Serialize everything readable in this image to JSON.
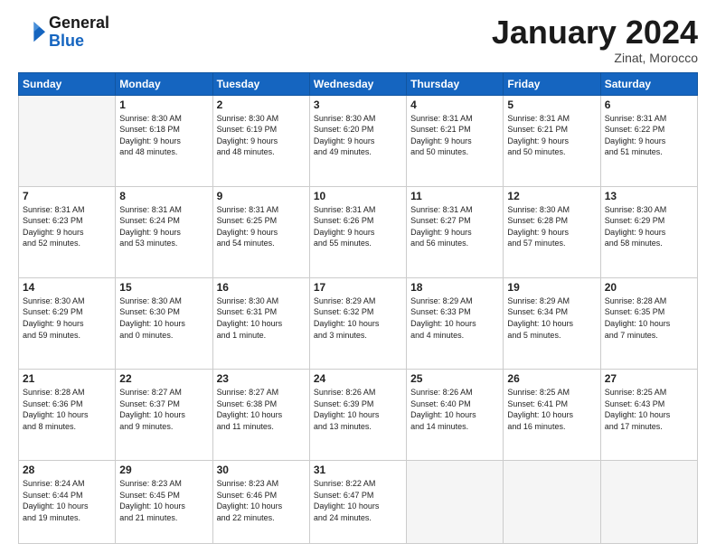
{
  "header": {
    "logo_general": "General",
    "logo_blue": "Blue",
    "month_title": "January 2024",
    "location": "Zinat, Morocco"
  },
  "days_of_week": [
    "Sunday",
    "Monday",
    "Tuesday",
    "Wednesday",
    "Thursday",
    "Friday",
    "Saturday"
  ],
  "weeks": [
    [
      {
        "day": "",
        "info": ""
      },
      {
        "day": "1",
        "info": "Sunrise: 8:30 AM\nSunset: 6:18 PM\nDaylight: 9 hours\nand 48 minutes."
      },
      {
        "day": "2",
        "info": "Sunrise: 8:30 AM\nSunset: 6:19 PM\nDaylight: 9 hours\nand 48 minutes."
      },
      {
        "day": "3",
        "info": "Sunrise: 8:30 AM\nSunset: 6:20 PM\nDaylight: 9 hours\nand 49 minutes."
      },
      {
        "day": "4",
        "info": "Sunrise: 8:31 AM\nSunset: 6:21 PM\nDaylight: 9 hours\nand 50 minutes."
      },
      {
        "day": "5",
        "info": "Sunrise: 8:31 AM\nSunset: 6:21 PM\nDaylight: 9 hours\nand 50 minutes."
      },
      {
        "day": "6",
        "info": "Sunrise: 8:31 AM\nSunset: 6:22 PM\nDaylight: 9 hours\nand 51 minutes."
      }
    ],
    [
      {
        "day": "7",
        "info": "Sunrise: 8:31 AM\nSunset: 6:23 PM\nDaylight: 9 hours\nand 52 minutes."
      },
      {
        "day": "8",
        "info": "Sunrise: 8:31 AM\nSunset: 6:24 PM\nDaylight: 9 hours\nand 53 minutes."
      },
      {
        "day": "9",
        "info": "Sunrise: 8:31 AM\nSunset: 6:25 PM\nDaylight: 9 hours\nand 54 minutes."
      },
      {
        "day": "10",
        "info": "Sunrise: 8:31 AM\nSunset: 6:26 PM\nDaylight: 9 hours\nand 55 minutes."
      },
      {
        "day": "11",
        "info": "Sunrise: 8:31 AM\nSunset: 6:27 PM\nDaylight: 9 hours\nand 56 minutes."
      },
      {
        "day": "12",
        "info": "Sunrise: 8:30 AM\nSunset: 6:28 PM\nDaylight: 9 hours\nand 57 minutes."
      },
      {
        "day": "13",
        "info": "Sunrise: 8:30 AM\nSunset: 6:29 PM\nDaylight: 9 hours\nand 58 minutes."
      }
    ],
    [
      {
        "day": "14",
        "info": "Sunrise: 8:30 AM\nSunset: 6:29 PM\nDaylight: 9 hours\nand 59 minutes."
      },
      {
        "day": "15",
        "info": "Sunrise: 8:30 AM\nSunset: 6:30 PM\nDaylight: 10 hours\nand 0 minutes."
      },
      {
        "day": "16",
        "info": "Sunrise: 8:30 AM\nSunset: 6:31 PM\nDaylight: 10 hours\nand 1 minute."
      },
      {
        "day": "17",
        "info": "Sunrise: 8:29 AM\nSunset: 6:32 PM\nDaylight: 10 hours\nand 3 minutes."
      },
      {
        "day": "18",
        "info": "Sunrise: 8:29 AM\nSunset: 6:33 PM\nDaylight: 10 hours\nand 4 minutes."
      },
      {
        "day": "19",
        "info": "Sunrise: 8:29 AM\nSunset: 6:34 PM\nDaylight: 10 hours\nand 5 minutes."
      },
      {
        "day": "20",
        "info": "Sunrise: 8:28 AM\nSunset: 6:35 PM\nDaylight: 10 hours\nand 7 minutes."
      }
    ],
    [
      {
        "day": "21",
        "info": "Sunrise: 8:28 AM\nSunset: 6:36 PM\nDaylight: 10 hours\nand 8 minutes."
      },
      {
        "day": "22",
        "info": "Sunrise: 8:27 AM\nSunset: 6:37 PM\nDaylight: 10 hours\nand 9 minutes."
      },
      {
        "day": "23",
        "info": "Sunrise: 8:27 AM\nSunset: 6:38 PM\nDaylight: 10 hours\nand 11 minutes."
      },
      {
        "day": "24",
        "info": "Sunrise: 8:26 AM\nSunset: 6:39 PM\nDaylight: 10 hours\nand 13 minutes."
      },
      {
        "day": "25",
        "info": "Sunrise: 8:26 AM\nSunset: 6:40 PM\nDaylight: 10 hours\nand 14 minutes."
      },
      {
        "day": "26",
        "info": "Sunrise: 8:25 AM\nSunset: 6:41 PM\nDaylight: 10 hours\nand 16 minutes."
      },
      {
        "day": "27",
        "info": "Sunrise: 8:25 AM\nSunset: 6:43 PM\nDaylight: 10 hours\nand 17 minutes."
      }
    ],
    [
      {
        "day": "28",
        "info": "Sunrise: 8:24 AM\nSunset: 6:44 PM\nDaylight: 10 hours\nand 19 minutes."
      },
      {
        "day": "29",
        "info": "Sunrise: 8:23 AM\nSunset: 6:45 PM\nDaylight: 10 hours\nand 21 minutes."
      },
      {
        "day": "30",
        "info": "Sunrise: 8:23 AM\nSunset: 6:46 PM\nDaylight: 10 hours\nand 22 minutes."
      },
      {
        "day": "31",
        "info": "Sunrise: 8:22 AM\nSunset: 6:47 PM\nDaylight: 10 hours\nand 24 minutes."
      },
      {
        "day": "",
        "info": ""
      },
      {
        "day": "",
        "info": ""
      },
      {
        "day": "",
        "info": ""
      }
    ]
  ]
}
